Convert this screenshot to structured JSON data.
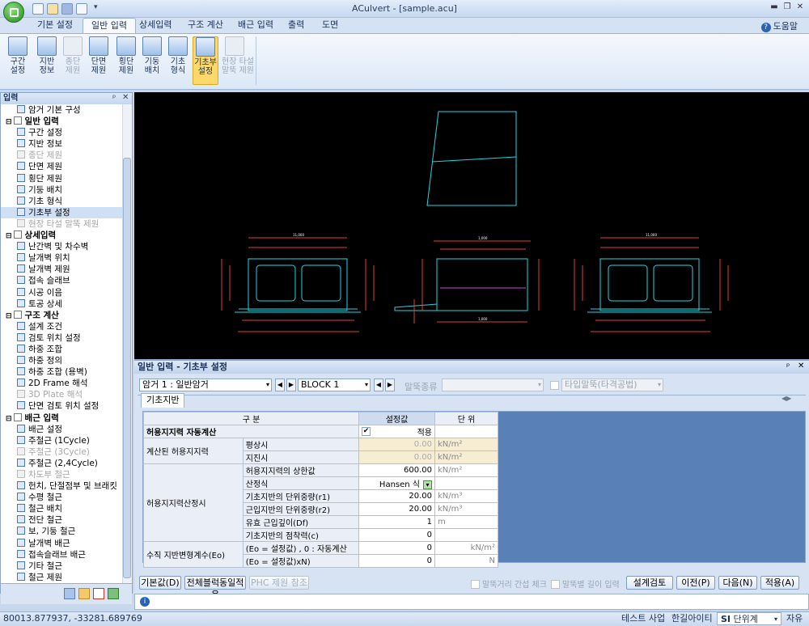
{
  "title": {
    "window": "ACulvert - [sample.acu]"
  },
  "tabs": [
    "기본 설정",
    "일반 입력",
    "상세입력",
    "구조 계산",
    "배근 입력",
    "출력",
    "도면"
  ],
  "help_label": "도움말",
  "ribbon": [
    {
      "label": "구간\n설정"
    },
    {
      "label": "지반\n정보"
    },
    {
      "label": "종단\n제원",
      "disabled": true
    },
    {
      "label": "단면\n제원"
    },
    {
      "label": "횡단\n제원"
    },
    {
      "label": "기둥\n배치"
    },
    {
      "label": "기초\n형식"
    },
    {
      "label": "기초부\n설정",
      "selected": true
    },
    {
      "label": "현장 타설\n말뚝 제원",
      "disabled": true
    }
  ],
  "left_panel": {
    "title": "입력",
    "tree": [
      {
        "label": "암거 기본 구성",
        "level": 1
      },
      {
        "label": "일반 입력",
        "group": true
      },
      {
        "label": "구간 설정",
        "level": 1
      },
      {
        "label": "지반 정보",
        "level": 1
      },
      {
        "label": "종단 제원",
        "level": 1,
        "disabled": true
      },
      {
        "label": "단면 제원",
        "level": 1
      },
      {
        "label": "횡단 제원",
        "level": 1
      },
      {
        "label": "기둥 배치",
        "level": 1
      },
      {
        "label": "기초 형식",
        "level": 1
      },
      {
        "label": "기초부 설정",
        "level": 1,
        "selected": true
      },
      {
        "label": "현장 타설 말뚝 제원",
        "level": 1,
        "disabled": true
      },
      {
        "label": "상세입력",
        "group": true
      },
      {
        "label": "난간벽 및 차수벽",
        "level": 1
      },
      {
        "label": "날개벽 위치",
        "level": 1
      },
      {
        "label": "날개벽 제원",
        "level": 1
      },
      {
        "label": "접속 슬래브",
        "level": 1
      },
      {
        "label": "시공 이음",
        "level": 1
      },
      {
        "label": "토공 상세",
        "level": 1
      },
      {
        "label": "구조 계산",
        "group": true
      },
      {
        "label": "설계 조건",
        "level": 1
      },
      {
        "label": "검토 위치 설정",
        "level": 1
      },
      {
        "label": "하중 조합",
        "level": 1
      },
      {
        "label": "하중 정의",
        "level": 1
      },
      {
        "label": "하중 조합 (용벽)",
        "level": 1
      },
      {
        "label": "2D Frame 해석",
        "level": 1
      },
      {
        "label": "3D Plate 해석",
        "level": 1,
        "disabled": true
      },
      {
        "label": "단면 검토 위치 설정",
        "level": 1
      },
      {
        "label": "배근 입력",
        "group": true
      },
      {
        "label": "배근 설정",
        "level": 1
      },
      {
        "label": "주철근 (1Cycle)",
        "level": 1
      },
      {
        "label": "주철근 (3Cycle)",
        "level": 1,
        "disabled": true
      },
      {
        "label": "주철근 (2,4Cycle)",
        "level": 1
      },
      {
        "label": "차도부 철근",
        "level": 1,
        "disabled": true
      },
      {
        "label": "헌치, 단절점부 및 브래킷",
        "level": 1
      },
      {
        "label": "수평 철근",
        "level": 1
      },
      {
        "label": "철근 배치",
        "level": 1
      },
      {
        "label": "전단 철근",
        "level": 1
      },
      {
        "label": "보, 기둥 철근",
        "level": 1
      },
      {
        "label": "날개벽 배근",
        "level": 1
      },
      {
        "label": "접속슬래브 배근",
        "level": 1
      },
      {
        "label": "기타 철근",
        "level": 1
      },
      {
        "label": "철근 제원",
        "level": 1
      }
    ]
  },
  "form": {
    "title": "일반 입력 - 기초부 설정",
    "culvert_select": "암거 1 : 일반암거",
    "block_select": "BLOCK  1",
    "pile_type_label": "말뚝종류",
    "pile_type_value": "",
    "toggle_label": "타입말뚝(타격공법)",
    "subtab": "기초지반",
    "columns": {
      "section": "구 분",
      "value": "설정값",
      "unit": "단 위"
    },
    "auto_row": {
      "label": "허용지지력 자동계산",
      "checkbox_label": "적용"
    },
    "rows": [
      {
        "group": "계산된 허용지지력",
        "name": "평상시",
        "value": "0.00",
        "unit": "kN/m²",
        "yellow": true,
        "dim": true
      },
      {
        "group": "",
        "name": "지진시",
        "value": "0.00",
        "unit": "kN/m²",
        "yellow": true,
        "dim": true
      },
      {
        "group": "허용지지력산정시",
        "name": "허용지지력의 상한값",
        "value": "600.00",
        "unit": "kN/m²"
      },
      {
        "group": "",
        "name": "산정식",
        "value": "Hansen 식",
        "unit": "",
        "dropdown": true
      },
      {
        "group": "",
        "name": "기초지반의 단위중량(r1)",
        "value": "20.00",
        "unit": "kN/m³"
      },
      {
        "group": "",
        "name": "근입지반의 단위중량(r2)",
        "value": "20.00",
        "unit": "kN/m³"
      },
      {
        "group": "",
        "name": "유효 근입깊이(Df)",
        "value": "1",
        "unit": "m"
      },
      {
        "group": "",
        "name": "기초지반의 점착력(c)",
        "value": "0",
        "unit": ""
      },
      {
        "group": "수직 지반변형계수(Eo)",
        "name": "(Eo = 설정값) , 0 : 자동계산",
        "value": "0",
        "unit": "kN/m²",
        "unit_right": true
      },
      {
        "group": "",
        "name": "(Eo = 설정값)xN)",
        "value": "0",
        "unit": "N",
        "unit_right": true
      }
    ],
    "buttons_left": [
      "기본값(D)",
      "전체블럭동일적용",
      "PHC 제원 참조"
    ],
    "check1": "말뚝거리 간섭 체크",
    "check2": "말뚝별 길이 입력",
    "buttons_right": [
      "설계검토",
      "이전(P)",
      "다음(N)",
      "적용(A)"
    ]
  },
  "status": {
    "coords": "80013.877937,  -33281.689769",
    "project": "테스트 사업",
    "company": "한길아이티",
    "unit_prefix": "SI",
    "unit": "단위계",
    "mode": "자유"
  },
  "cad_texts": [
    "11,000",
    "1,000",
    "1,000",
    "11,000"
  ]
}
